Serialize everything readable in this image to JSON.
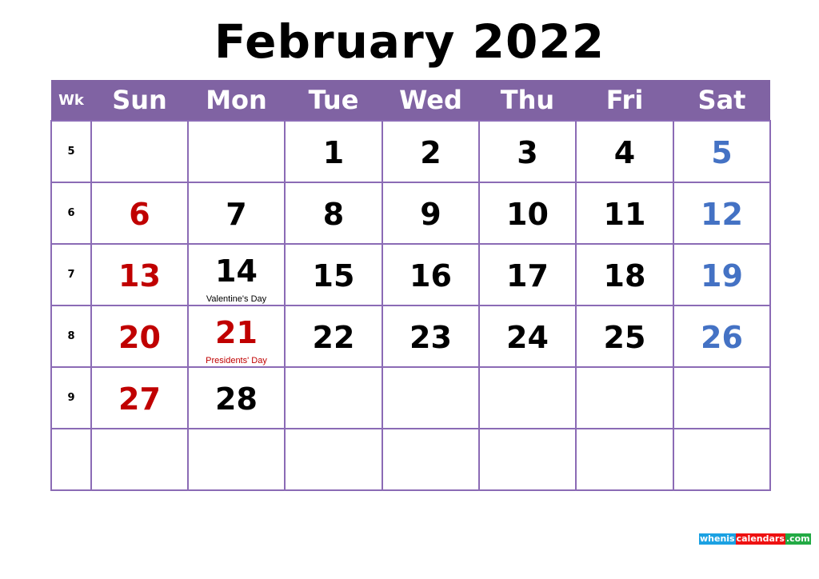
{
  "title": "February 2022",
  "header": [
    "Wk",
    "Sun",
    "Mon",
    "Tue",
    "Wed",
    "Thu",
    "Fri",
    "Sat"
  ],
  "colors": {
    "header_bg": "#8063a3",
    "sunday": "#c00000",
    "saturday": "#4472c4",
    "holiday": "#c00000"
  },
  "weeks": [
    {
      "wk": "5",
      "days": [
        "",
        "",
        "1",
        "2",
        "3",
        "4",
        "5"
      ]
    },
    {
      "wk": "6",
      "days": [
        "6",
        "7",
        "8",
        "9",
        "10",
        "11",
        "12"
      ]
    },
    {
      "wk": "7",
      "days": [
        "13",
        "14",
        "15",
        "16",
        "17",
        "18",
        "19"
      ]
    },
    {
      "wk": "8",
      "days": [
        "20",
        "21",
        "22",
        "23",
        "24",
        "25",
        "26"
      ]
    },
    {
      "wk": "9",
      "days": [
        "27",
        "28",
        "",
        "",
        "",
        "",
        ""
      ]
    },
    {
      "wk": "",
      "days": [
        "",
        "",
        "",
        "",
        "",
        "",
        ""
      ]
    }
  ],
  "holidays": {
    "14": {
      "name": "Valentine's Day",
      "red": false
    },
    "21": {
      "name": "Presidents' Day",
      "red": true
    }
  },
  "logo": {
    "part1": "whenis",
    "part2": "calendars",
    "part3": ".com",
    "c1": "#1ba1e2",
    "c2": "#ee1111",
    "c3": "#22aa44"
  }
}
